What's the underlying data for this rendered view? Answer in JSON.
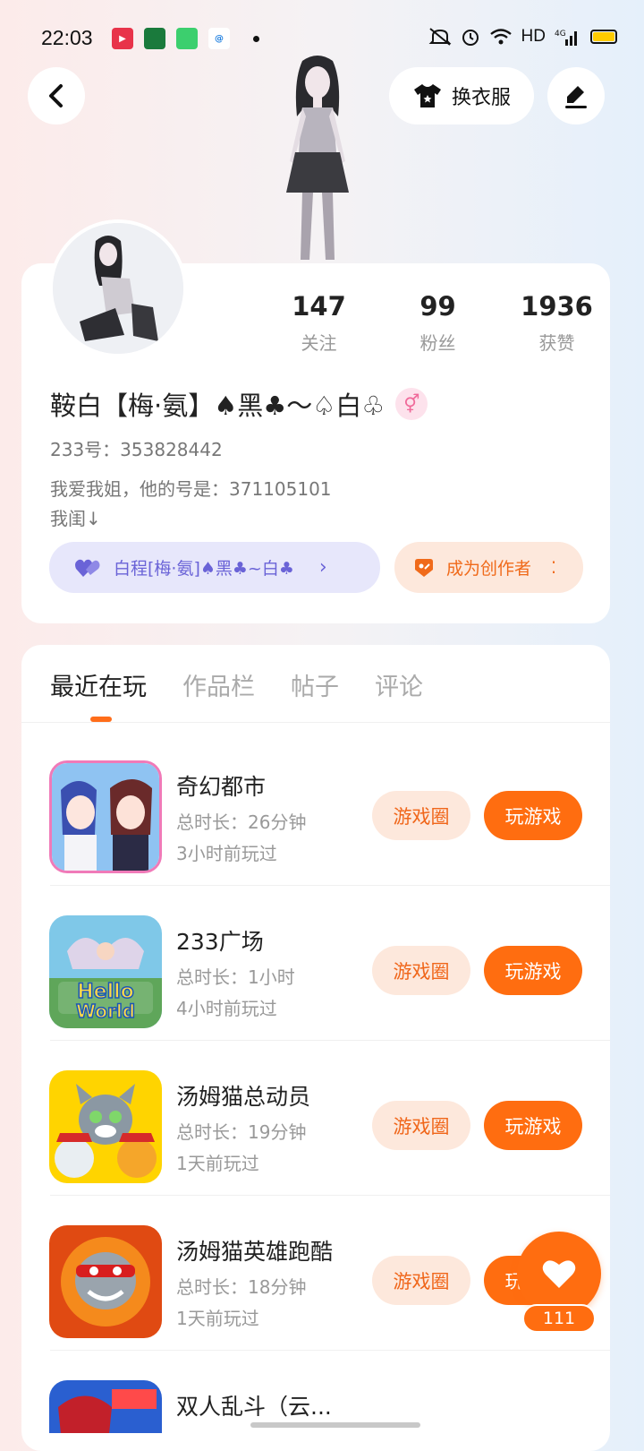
{
  "status_bar": {
    "time": "22:03",
    "right_text": "HD",
    "network": "4G",
    "icons": [
      "video-app-icon",
      "bank-app-icon",
      "android-app-icon",
      "browser-app-icon",
      "mute-icon",
      "alarm-icon",
      "wifi-icon",
      "signal-icon",
      "battery-icon"
    ]
  },
  "header": {
    "dress_label": "换衣服"
  },
  "profile": {
    "stats": [
      {
        "num": "147",
        "label": "关注"
      },
      {
        "num": "99",
        "label": "粉丝"
      },
      {
        "num": "1936",
        "label": "获赞"
      }
    ],
    "nickname": "鞍白【梅·氨】♠黑♣〜♤白♧",
    "gender_symbol": "⚥",
    "uid": "233号：353828442",
    "bio_line1": "我爱我姐，他的号是：371105101",
    "bio_line2": "我闺↓",
    "family_label": "白程[梅·氨]♠黑♣~白♣",
    "creator_label": "成为创作者"
  },
  "tabs": [
    "最近在玩",
    "作品栏",
    "帖子",
    "评论"
  ],
  "games": [
    {
      "name": "奇幻都市",
      "duration": "总时长：26分钟",
      "last_played": "3小时前玩过",
      "circle_label": "游戏圈",
      "play_label": "玩游戏"
    },
    {
      "name": "233广场",
      "duration": "总时长：1小时",
      "last_played": "4小时前玩过",
      "circle_label": "游戏圈",
      "play_label": "玩游戏"
    },
    {
      "name": "汤姆猫总动员",
      "duration": "总时长：19分钟",
      "last_played": "1天前玩过",
      "circle_label": "游戏圈",
      "play_label": "玩游戏"
    },
    {
      "name": "汤姆猫英雄跑酷",
      "duration": "总时长：18分钟",
      "last_played": "1天前玩过",
      "circle_label": "游戏圈",
      "play_label": "玩游戏"
    },
    {
      "name": "双人乱斗（云..."
    }
  ],
  "like": {
    "count": "111"
  },
  "colors": {
    "accent": "#ff6d10",
    "accent_light": "#fde8dc",
    "family": "#6a63d7"
  }
}
